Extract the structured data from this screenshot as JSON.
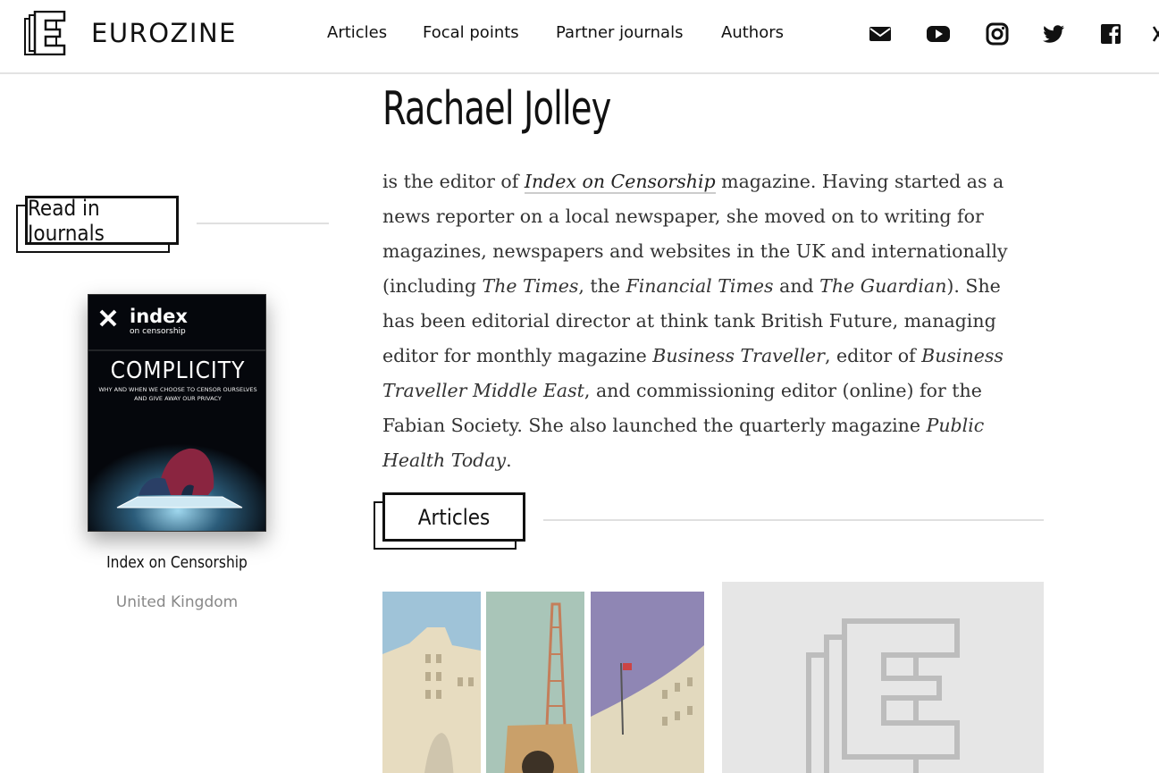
{
  "brand": {
    "name": "EUROZINE",
    "logo_icon": "eurozine-logo"
  },
  "nav": [
    {
      "label": "Articles"
    },
    {
      "label": "Focal points"
    },
    {
      "label": "Partner journals"
    },
    {
      "label": "Authors"
    }
  ],
  "social": [
    "mail-icon",
    "youtube-icon",
    "instagram-icon",
    "twitter-icon",
    "facebook-icon"
  ],
  "side": {
    "section_label": "Read in Journals",
    "journal": {
      "name": "Index on Censorship",
      "country": "United Kingdom",
      "cover": {
        "logo_main": "index",
        "logo_sub": "on censorship",
        "headline": "COMPLICITY",
        "subhead_1": "WHY AND WHEN WE CHOOSE TO CENSOR OURSELVES",
        "subhead_2": "AND GIVE AWAY OUR PRIVACY"
      }
    }
  },
  "author": {
    "name": "Rachael Jolley",
    "bio": {
      "t1": "is the editor of ",
      "link": "Index on Censorship",
      "t2": " magazine. Having started as a news reporter on a local newspaper, she moved on to writing for magazines, newspapers and websites in the UK and internationally (including ",
      "i1": "The Times",
      "t3": ", the ",
      "i2": "Financial Times",
      "t4": " and ",
      "i3": "The Guardian",
      "t5": "). She has been editorial director at think tank British Future, managing editor for monthly magazine ",
      "i4": "Business Traveller",
      "t6": ", editor of ",
      "i5": "Business Traveller Middle East",
      "t7": ", and commissioning editor (online) for the Fabian Society. She also launched the quarterly magazine ",
      "i6": "Public Health Today",
      "t8": "."
    }
  },
  "articles": {
    "section_label": "Articles"
  },
  "colors": {
    "accent": "#111111",
    "muted": "#888888",
    "rule": "#e0e0e0",
    "placeholder": "#e6e6e6"
  }
}
